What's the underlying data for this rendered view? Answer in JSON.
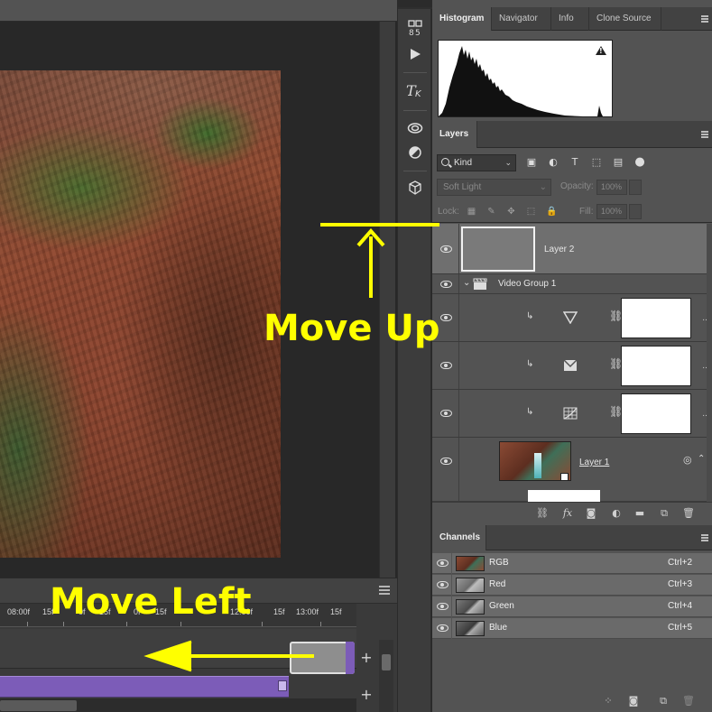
{
  "collapse": {
    "left": "«",
    "right": "»"
  },
  "histogram_panel": {
    "tabs": [
      {
        "label": "Histogram",
        "active": true
      },
      {
        "label": "Navigator",
        "active": false
      },
      {
        "label": "Info",
        "active": false
      },
      {
        "label": "Clone Source",
        "active": false
      }
    ],
    "warning_icon": "warning-icon"
  },
  "layers_panel": {
    "tab": "Layers",
    "filter_kind": "Kind",
    "blend_mode": "Soft Light",
    "opacity_label": "Opacity:",
    "opacity_value": "100%",
    "lock_label": "Lock:",
    "fill_label": "Fill:",
    "fill_value": "100%",
    "layers": [
      {
        "name": "Layer 2",
        "type": "gray-fill",
        "selected": true
      },
      {
        "name": "Video Group 1",
        "type": "group"
      },
      {
        "name": "",
        "type": "adjustment",
        "icon": "levels-triangle-icon"
      },
      {
        "name": "",
        "type": "adjustment",
        "icon": "channel-mixer-icon"
      },
      {
        "name": "",
        "type": "adjustment",
        "icon": "curves-grid-icon"
      },
      {
        "name": "Layer 1",
        "type": "smart-object"
      }
    ]
  },
  "channels_panel": {
    "tab": "Channels",
    "channels": [
      {
        "name": "RGB",
        "shortcut": "Ctrl+2"
      },
      {
        "name": "Red",
        "shortcut": "Ctrl+3"
      },
      {
        "name": "Green",
        "shortcut": "Ctrl+4"
      },
      {
        "name": "Blue",
        "shortcut": "Ctrl+5"
      }
    ]
  },
  "timeline": {
    "ruler_labels": [
      "08:00f",
      "15f",
      "0f",
      "15f",
      "0f",
      "15f",
      "12:00f",
      "15f",
      "13:00f",
      "15f"
    ],
    "add_label": "+"
  },
  "toolstrip": {
    "icons": [
      "swatch-swap-icon",
      "play-icon",
      "type-tool-icon",
      "creative-cloud-icon",
      "adjustments-icon",
      "3d-cube-icon"
    ]
  },
  "annotations": {
    "move_up": "Move Up",
    "move_left": "Move Left",
    "color": "#ffff00"
  },
  "colors": {
    "panel_bg": "#535353",
    "selected_row": "#6f6f6f",
    "video_track": "#7c5cb8",
    "canvas_bg": "#282828"
  }
}
